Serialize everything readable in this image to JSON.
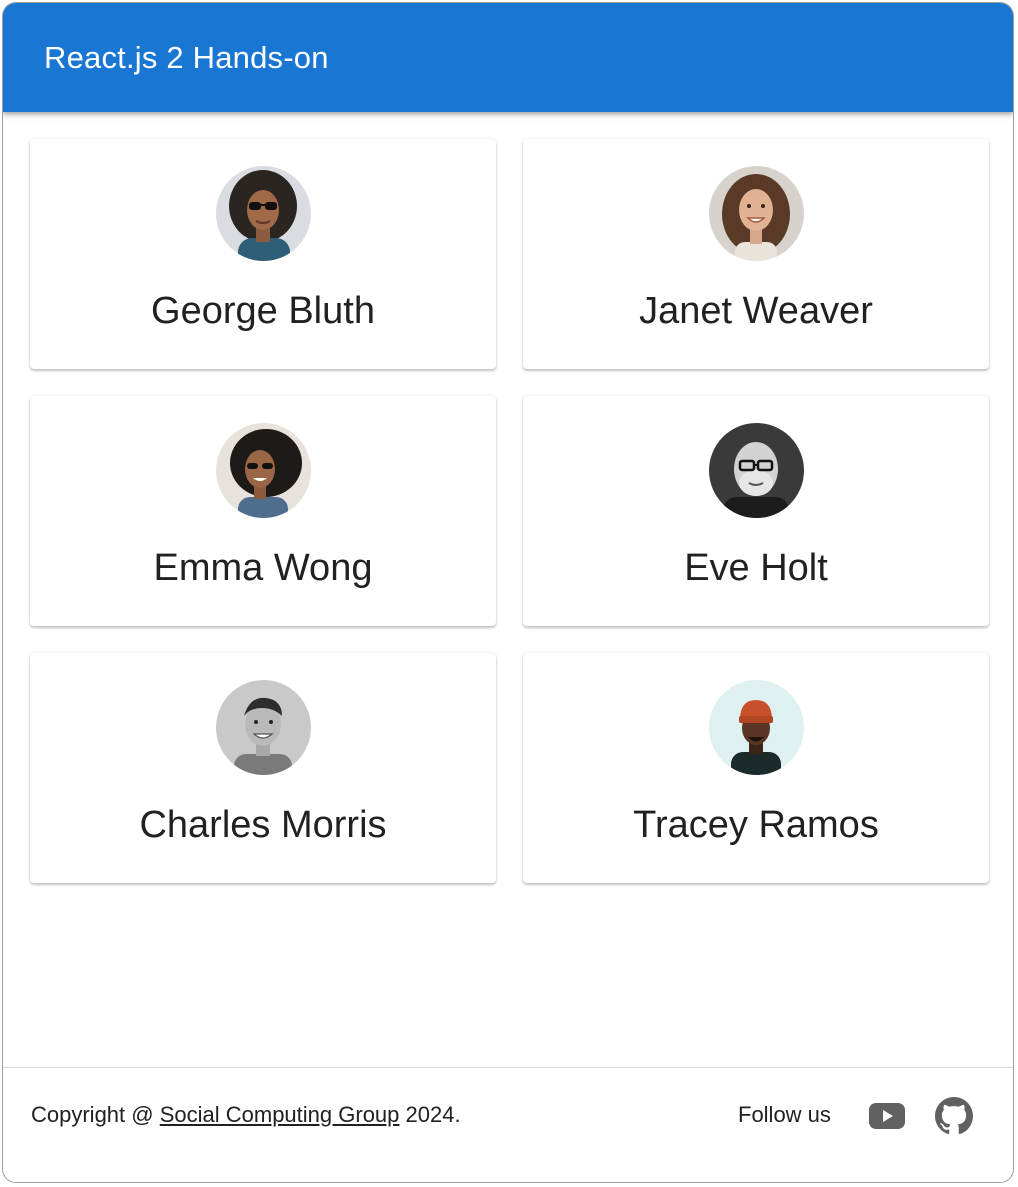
{
  "app_bar": {
    "title": "React.js 2 Hands-on",
    "color": "#1976d2"
  },
  "users": [
    {
      "name": "George Bluth",
      "avatar": "avatar-george-bluth"
    },
    {
      "name": "Janet Weaver",
      "avatar": "avatar-janet-weaver"
    },
    {
      "name": "Emma Wong",
      "avatar": "avatar-emma-wong"
    },
    {
      "name": "Eve Holt",
      "avatar": "avatar-eve-holt"
    },
    {
      "name": "Charles Morris",
      "avatar": "avatar-charles-morris"
    },
    {
      "name": "Tracey Ramos",
      "avatar": "avatar-tracey-ramos"
    }
  ],
  "footer": {
    "copyright_prefix": "Copyright @ ",
    "link_text": "Social Computing Group",
    "copyright_suffix": " 2024.",
    "follow_label": "Follow us",
    "icons": [
      "youtube-icon",
      "github-icon"
    ]
  }
}
